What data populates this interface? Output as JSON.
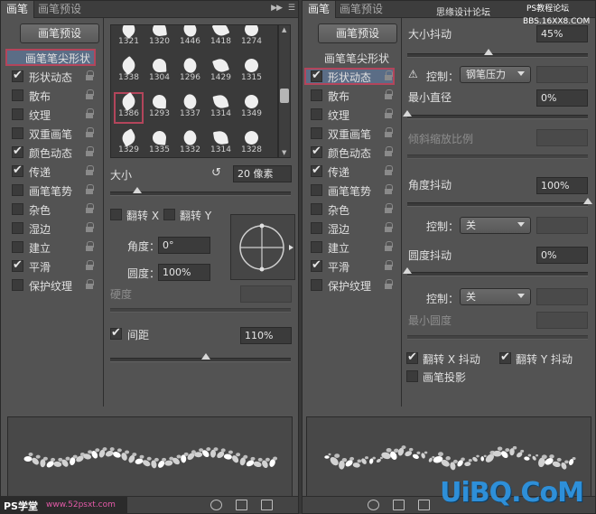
{
  "left": {
    "tabs": [
      "画笔",
      "画笔预设"
    ],
    "preset_button": "画笔预设",
    "sidebar": [
      {
        "label": "画笔笔尖形状",
        "checkbox": false,
        "state": "selected"
      },
      {
        "label": "形状动态",
        "checkbox": true,
        "checked": true
      },
      {
        "label": "散布",
        "checkbox": true,
        "checked": false
      },
      {
        "label": "纹理",
        "checkbox": true,
        "checked": false
      },
      {
        "label": "双重画笔",
        "checkbox": true,
        "checked": false
      },
      {
        "label": "颜色动态",
        "checkbox": true,
        "checked": true
      },
      {
        "label": "传递",
        "checkbox": true,
        "checked": true
      },
      {
        "label": "画笔笔势",
        "checkbox": true,
        "checked": false
      },
      {
        "label": "杂色",
        "checkbox": true,
        "checked": false
      },
      {
        "label": "湿边",
        "checkbox": true,
        "checked": false
      },
      {
        "label": "建立",
        "checkbox": true,
        "checked": false
      },
      {
        "label": "平滑",
        "checkbox": true,
        "checked": true
      },
      {
        "label": "保护纹理",
        "checkbox": true,
        "checked": false
      }
    ],
    "brush_tips": [
      "1321",
      "1320",
      "1446",
      "1418",
      "1274",
      "1338",
      "1304",
      "1296",
      "1429",
      "1315",
      "1386",
      "1293",
      "1337",
      "1314",
      "1349",
      "1329",
      "1335",
      "1332",
      "1314",
      "1328"
    ],
    "selected_tip": "1386",
    "size_label": "大小",
    "size_value": "20 像素",
    "size_level": 0.15,
    "flip_x": "翻转 X",
    "flip_y": "翻转 Y",
    "angle_label": "角度：",
    "angle_value": "0°",
    "roundness_label": "圆度：",
    "roundness_value": "100%",
    "hardness_label": "硬度",
    "spacing_label": "间距",
    "spacing_value": "110%",
    "spacing_level": 0.53
  },
  "right": {
    "tabs": [
      "画笔",
      "画笔预设"
    ],
    "preset_button": "画笔预设",
    "sidebar": [
      {
        "label": "画笔笔尖形状",
        "checkbox": false
      },
      {
        "label": "形状动态",
        "checkbox": true,
        "checked": true,
        "state": "selected"
      },
      {
        "label": "散布",
        "checkbox": true,
        "checked": false
      },
      {
        "label": "纹理",
        "checkbox": true,
        "checked": false
      },
      {
        "label": "双重画笔",
        "checkbox": true,
        "checked": false
      },
      {
        "label": "颜色动态",
        "checkbox": true,
        "checked": true
      },
      {
        "label": "传递",
        "checkbox": true,
        "checked": true
      },
      {
        "label": "画笔笔势",
        "checkbox": true,
        "checked": false
      },
      {
        "label": "杂色",
        "checkbox": true,
        "checked": false
      },
      {
        "label": "湿边",
        "checkbox": true,
        "checked": false
      },
      {
        "label": "建立",
        "checkbox": true,
        "checked": false
      },
      {
        "label": "平滑",
        "checkbox": true,
        "checked": true
      },
      {
        "label": "保护纹理",
        "checkbox": true,
        "checked": false
      }
    ],
    "size_jitter_label": "大小抖动",
    "size_jitter_value": "45%",
    "size_jitter_level": 0.45,
    "control_label": "控制：",
    "control_value_1": "钢笔压力",
    "min_diameter_label": "最小直径",
    "min_diameter_value": "0%",
    "tilt_scale_label": "倾斜缩放比例",
    "angle_jitter_label": "角度抖动",
    "angle_jitter_value": "100%",
    "control_value_2": "关",
    "roundness_jitter_label": "圆度抖动",
    "roundness_jitter_value": "0%",
    "control_value_3": "关",
    "min_roundness_label": "最小圆度",
    "flip_x_jitter": "翻转 X 抖动",
    "flip_y_jitter": "翻转 Y 抖动",
    "brush_projection": "画笔投影"
  },
  "watermarks": {
    "top_right_1": "思缘设计论坛",
    "top_right_2": "PS教程论坛",
    "top_right_3": "BBS.16XX8.COM",
    "bottom_left_1": "PS学堂",
    "bottom_left_2": "www.52psxt.com",
    "logo": "UiBQ.CoM"
  },
  "colors": {
    "panel_bg": "#535353",
    "highlight_box": "#b3455b",
    "selection": "#5b6d86",
    "logo": "#2e8fd8"
  }
}
